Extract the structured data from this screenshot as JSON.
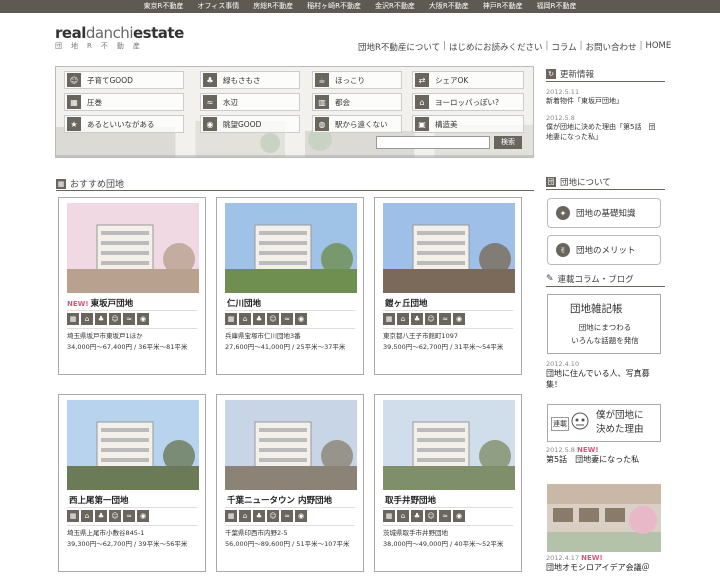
{
  "topnav": [
    "東京R不動産",
    "オフィス事情",
    "房総R不動産",
    "稲村ヶ崎R不動産",
    "金沢R不動産",
    "大阪R不動産",
    "神戸R不動産",
    "福岡R不動産"
  ],
  "logo": {
    "part1": "real",
    "part2": "danchi",
    "part3": "estate",
    "sub": "団地R不動産"
  },
  "globalnav": [
    "団地R不動産について",
    "はじめにお読みください",
    "コラム",
    "お問い合わせ",
    "HOME"
  ],
  "categories": [
    {
      "label": "子育てGOOD",
      "icon": "child-icon"
    },
    {
      "label": "緑もさもさ",
      "icon": "leaf-icon"
    },
    {
      "label": "ほっこり",
      "icon": "tea-icon"
    },
    {
      "label": "シェアOK",
      "icon": "share-icon"
    },
    {
      "label": "圧巻",
      "icon": "building-icon"
    },
    {
      "label": "水辺",
      "icon": "water-icon"
    },
    {
      "label": "都会",
      "icon": "city-icon"
    },
    {
      "label": "ヨーロッパっぽい?",
      "icon": "euro-icon"
    },
    {
      "label": "あるといいながある",
      "icon": "star-icon"
    },
    {
      "label": "眺望GOOD",
      "icon": "view-icon"
    },
    {
      "label": "駅から遠くない",
      "icon": "train-icon"
    },
    {
      "label": "構造美",
      "icon": "structure-icon"
    }
  ],
  "search": {
    "button": "検索",
    "placeholder": ""
  },
  "news": {
    "heading": "更新情報",
    "items": [
      {
        "date": "2012.5.11",
        "text": "新着物件「東坂戸団地」"
      },
      {
        "date": "2012.5.8",
        "text": "僕が団地に決めた理由「第5話　団",
        "text2": "地妻になった私」"
      }
    ]
  },
  "recommend": {
    "heading": "おすすめ団地"
  },
  "cards": [
    {
      "new": "NEW!",
      "name": "東坂戸団地",
      "addr": "埼玉県坂戸市東坂戸1ほか",
      "price": "34,000円～67,400円 / 36平米～81平米"
    },
    {
      "new": "",
      "name": "仁川団地",
      "addr": "兵庫県宝塚市仁川団地3番",
      "price": "27,600円～41,000円 / 25平米～37平米"
    },
    {
      "new": "",
      "name": "鎧ヶ丘団地",
      "addr": "東京都八王子市館町1097",
      "price": "39,500円～62,700円 / 31平米～54平米"
    },
    {
      "new": "",
      "name": "西上尾第一団地",
      "addr": "埼玉県上尾市小敷谷845-1",
      "price": "39,300円～62,700円 / 39平米～56平米"
    },
    {
      "new": "",
      "name": "千葉ニュータウン 内野団地",
      "addr": "千葉県印西市内野2-5",
      "price": "56,000円～89,600円 / 51平米～107平米"
    },
    {
      "new": "",
      "name": "取手井野団地",
      "addr": "茨城県取手市井野団地",
      "price": "38,000円～49,000円 / 40平米～52平米"
    }
  ],
  "about": {
    "heading": "団地について",
    "btn1": "団地の基礎知識",
    "btn2": "団地のメリット",
    "serial": "連載コラム・ブログ",
    "zakki_title": "団地雑記帳",
    "zakki_sub1": "団地にまつわる",
    "zakki_sub2": "いろんな話題を発信",
    "post1_date": "2012.4.10",
    "post1_text": "団地に住んでいる人、写真募",
    "post1_text2": "集！",
    "riyuu1": "僕が団地に",
    "riyuu2": "決めた理由",
    "riyuu_tag": "連載",
    "post2_date": "2012.5.8",
    "post2_new": "NEW!",
    "post2_text": "第5話　団地妻になった私",
    "post3_date": "2012.4.17",
    "post3_new": "NEW!",
    "post3_text": "団地オモシロアイデア会議＠"
  }
}
